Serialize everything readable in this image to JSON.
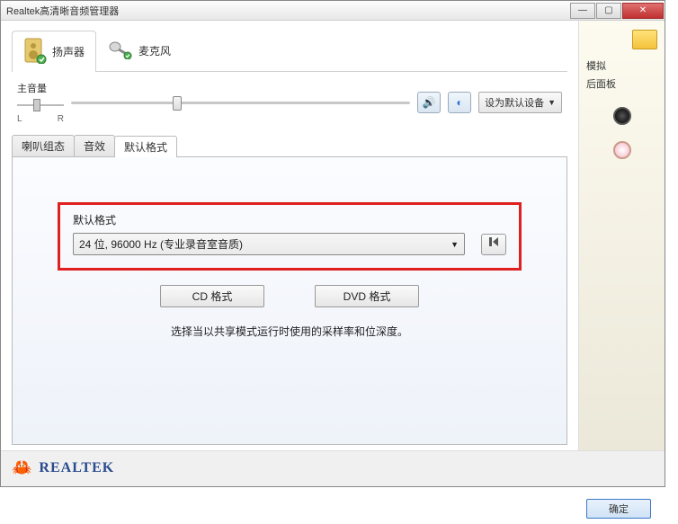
{
  "window": {
    "title": "Realtek高清晰音频管理器"
  },
  "deviceTabs": {
    "speaker": "扬声器",
    "mic": "麦克风"
  },
  "volume": {
    "label": "主音量",
    "left": "L",
    "right": "R"
  },
  "defaultDevice": {
    "label": "设为默认设备"
  },
  "subtabs": {
    "config": "喇叭组态",
    "effect": "音效",
    "format": "默认格式"
  },
  "formatPanel": {
    "label": "默认格式",
    "selected": "24 位, 96000 Hz (专业录音室音质)",
    "cd": "CD 格式",
    "dvd": "DVD 格式",
    "hint": "选择当以共享模式运行时使用的采样率和位深度。"
  },
  "side": {
    "analog": "模拟",
    "rearPanel": "后面板"
  },
  "brand": "REALTEK",
  "ok": "确定"
}
